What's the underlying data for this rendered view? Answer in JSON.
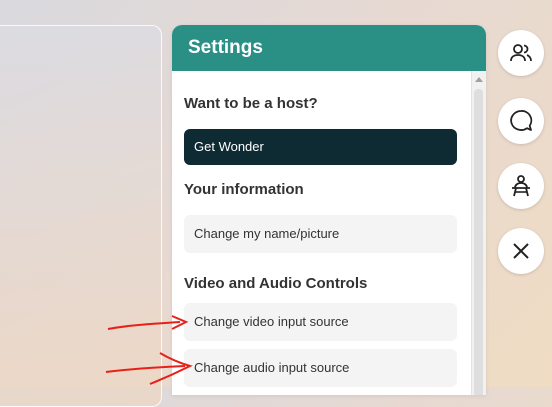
{
  "settings_panel": {
    "title": "Settings",
    "host_section_title": "Want to be a host?",
    "get_wonder_label": "Get Wonder",
    "info_section_title": "Your information",
    "change_name_label": "Change my name/picture",
    "av_section_title": "Video and Audio Controls",
    "change_video_label": "Change video input source",
    "change_audio_label": "Change audio input source"
  },
  "side_buttons": [
    {
      "icon": "people-icon"
    },
    {
      "icon": "chat-bubble-icon"
    },
    {
      "icon": "host-desk-icon"
    },
    {
      "icon": "close-icon"
    }
  ],
  "colors": {
    "header_teal": "#2a8f85",
    "dark_button": "#0e2a33",
    "annotation_red": "#e8201a"
  }
}
